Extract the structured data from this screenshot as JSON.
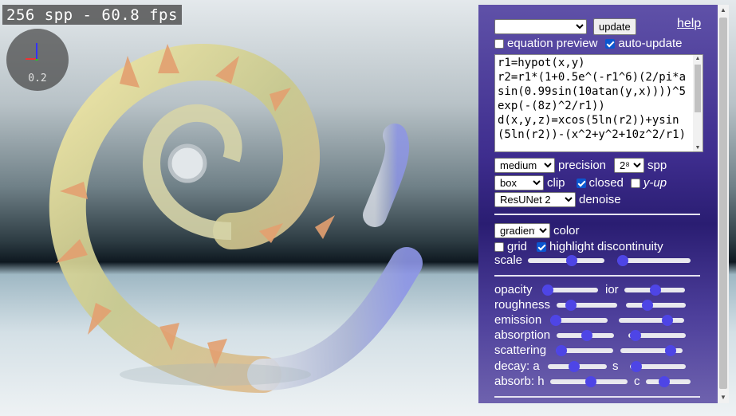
{
  "overlay": {
    "fps_text": "256 spp - 60.8 fps",
    "zoom_value": "0.2"
  },
  "panel": {
    "preset_select": "",
    "update_label": "update",
    "help_label": "help",
    "equation_preview_label": "equation preview",
    "equation_preview_checked": false,
    "auto_update_label": "auto-update",
    "auto_update_checked": true,
    "equation_text": "r1=hypot(x,y)\nr2=r1*(1+0.5e^(-r1^6)(2/pi*asin(0.99sin(10atan(y,x))))^5exp(-(8z)^2/r1))\nd(x,y,z)=xcos(5ln(r2))+ysin(5ln(r2))-(x^2+y^2+10z^2/r1)",
    "precision_value": "medium",
    "precision_label": "precision",
    "spp_value": "2⁸",
    "spp_label": "spp",
    "clip_value": "box",
    "clip_label": "clip",
    "closed_label": "closed",
    "closed_checked": true,
    "yup_label": "y-up",
    "yup_checked": false,
    "denoise_value": "ResUNet 2",
    "denoise_label": "denoise",
    "color_value": "gradient",
    "color_label": "color",
    "grid_label": "grid",
    "grid_checked": false,
    "highlight_label": "highlight discontinuity",
    "highlight_checked": true,
    "scale_label": "scale",
    "opacity_label": "opacity",
    "ior_label": "ior",
    "roughness_label": "roughness",
    "emission_label": "emission",
    "absorption_label": "absorption",
    "scattering_label": "scattering",
    "decay_label": "decay: a",
    "decay_s_label": "s",
    "absorb_label": "absorb: h",
    "absorb_c_label": "c",
    "slider_levels": {
      "scale_a": 0.58,
      "scale_b": 0.0,
      "opacity": 0.0,
      "ior": 0.52,
      "roughness_a": 0.18,
      "roughness_b": 0.33,
      "emission_a": 0.0,
      "emission_b": 0.8,
      "absorption_a": 0.53,
      "absorption_b": 0.03,
      "scattering_a": 0.0,
      "scattering_b": 0.88,
      "decay_a": 0.43,
      "decay_s": 0.02,
      "absorb_h": 0.53,
      "absorb_c": 0.38
    },
    "accent_color": "#4e45e6"
  }
}
